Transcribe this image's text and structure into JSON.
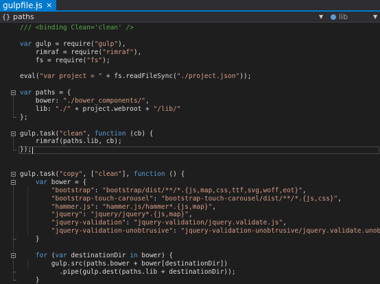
{
  "tab": {
    "title": "gulpfile.js",
    "pin_icon": "pin-icon",
    "close_icon": "close-icon"
  },
  "navbar": {
    "scope_icon": "braces-icon",
    "scope_icon_glyph": "{}",
    "scope_label": "paths",
    "member_icon": "object-icon",
    "member_label": "lib",
    "dropdown_icon": "dropdown-arrow-icon"
  },
  "colors": {
    "keyword": "#569cd6",
    "string": "#d69d85",
    "comment": "#57a64a",
    "plain": "#dcdcdc",
    "accent": "#007acc",
    "background": "#1e1e1e"
  },
  "code": {
    "lines": [
      [
        {
          "c": "com",
          "t": "/// <binding Clean='clean' />"
        }
      ],
      [],
      [
        {
          "c": "kw",
          "t": "var"
        },
        {
          "c": "pl",
          "t": " gulp = require("
        },
        {
          "c": "str",
          "t": "\"gulp\""
        },
        {
          "c": "pl",
          "t": "),"
        }
      ],
      [
        {
          "c": "pl",
          "t": "    rimraf = require("
        },
        {
          "c": "str",
          "t": "\"rimraf\""
        },
        {
          "c": "pl",
          "t": "),"
        }
      ],
      [
        {
          "c": "pl",
          "t": "    fs = require("
        },
        {
          "c": "str",
          "t": "\"fs\""
        },
        {
          "c": "pl",
          "t": ");"
        }
      ],
      [],
      [
        {
          "c": "pl",
          "t": "eval("
        },
        {
          "c": "str",
          "t": "\"var project = \""
        },
        {
          "c": "pl",
          "t": " + fs.readFileSync("
        },
        {
          "c": "str",
          "t": "\"./project.json\""
        },
        {
          "c": "pl",
          "t": "));"
        }
      ],
      [],
      [
        {
          "c": "kw",
          "t": "var"
        },
        {
          "c": "pl",
          "t": " paths = {"
        }
      ],
      [
        {
          "c": "pl",
          "t": "    bower: "
        },
        {
          "c": "str",
          "t": "\"./bower_components/\""
        },
        {
          "c": "pl",
          "t": ","
        }
      ],
      [
        {
          "c": "pl",
          "t": "    lib: "
        },
        {
          "c": "str",
          "t": "\"./\""
        },
        {
          "c": "pl",
          "t": " + project.webroot + "
        },
        {
          "c": "str",
          "t": "\"/lib/\""
        }
      ],
      [
        {
          "c": "pl",
          "t": "};"
        }
      ],
      [],
      [
        {
          "c": "pl",
          "t": "gulp.task("
        },
        {
          "c": "str",
          "t": "\"clean\""
        },
        {
          "c": "pl",
          "t": ", "
        },
        {
          "c": "kw",
          "t": "function"
        },
        {
          "c": "pl",
          "t": " (cb) {"
        }
      ],
      [
        {
          "c": "pl",
          "t": "    rimraf(paths.lib, cb);"
        }
      ],
      [
        {
          "c": "pl",
          "t": "});"
        }
      ],
      [],
      [],
      [
        {
          "c": "pl",
          "t": "gulp.task("
        },
        {
          "c": "str",
          "t": "\"copy\""
        },
        {
          "c": "pl",
          "t": ", ["
        },
        {
          "c": "str",
          "t": "\"clean\""
        },
        {
          "c": "pl",
          "t": "], "
        },
        {
          "c": "kw",
          "t": "function"
        },
        {
          "c": "pl",
          "t": " () {"
        }
      ],
      [
        {
          "c": "pl",
          "t": "    "
        },
        {
          "c": "kw",
          "t": "var"
        },
        {
          "c": "pl",
          "t": " bower = {"
        }
      ],
      [
        {
          "c": "pl",
          "t": "        "
        },
        {
          "c": "str",
          "t": "\"bootstrap\""
        },
        {
          "c": "pl",
          "t": ": "
        },
        {
          "c": "str",
          "t": "\"bootstrap/dist/**/*.{js,map,css,ttf,svg,woff,eot}\""
        },
        {
          "c": "pl",
          "t": ","
        }
      ],
      [
        {
          "c": "pl",
          "t": "        "
        },
        {
          "c": "str",
          "t": "\"bootstrap-touch-carousel\""
        },
        {
          "c": "pl",
          "t": ": "
        },
        {
          "c": "str",
          "t": "\"bootstrap-touch-carousel/dist/**/*.{js,css}\""
        },
        {
          "c": "pl",
          "t": ","
        }
      ],
      [
        {
          "c": "pl",
          "t": "        "
        },
        {
          "c": "str",
          "t": "\"hammer.js\""
        },
        {
          "c": "pl",
          "t": ": "
        },
        {
          "c": "str",
          "t": "\"hammer.js/hammer*.{js,map}\""
        },
        {
          "c": "pl",
          "t": ","
        }
      ],
      [
        {
          "c": "pl",
          "t": "        "
        },
        {
          "c": "str",
          "t": "\"jquery\""
        },
        {
          "c": "pl",
          "t": ": "
        },
        {
          "c": "str",
          "t": "\"jquery/jquery*.{js,map}\""
        },
        {
          "c": "pl",
          "t": ","
        }
      ],
      [
        {
          "c": "pl",
          "t": "        "
        },
        {
          "c": "str",
          "t": "\"jquery-validation\""
        },
        {
          "c": "pl",
          "t": ": "
        },
        {
          "c": "str",
          "t": "\"jquery-validation/jquery.validate.js\""
        },
        {
          "c": "pl",
          "t": ","
        }
      ],
      [
        {
          "c": "pl",
          "t": "        "
        },
        {
          "c": "str",
          "t": "\"jquery-validation-unobtrusive\""
        },
        {
          "c": "pl",
          "t": ": "
        },
        {
          "c": "str",
          "t": "\"jquery-validation-unobtrusive/jquery.validate.unobtrusive.js\""
        }
      ],
      [
        {
          "c": "pl",
          "t": "    }"
        }
      ],
      [],
      [
        {
          "c": "pl",
          "t": "    "
        },
        {
          "c": "kw",
          "t": "for"
        },
        {
          "c": "pl",
          "t": " ("
        },
        {
          "c": "kw",
          "t": "var"
        },
        {
          "c": "pl",
          "t": " destinationDir "
        },
        {
          "c": "kw",
          "t": "in"
        },
        {
          "c": "pl",
          "t": " bower) {"
        }
      ],
      [
        {
          "c": "pl",
          "t": "        gulp.src(paths.bower + bower[destinationDir])"
        }
      ],
      [
        {
          "c": "pl",
          "t": "          .pipe(gulp.dest(paths.lib + destinationDir));"
        }
      ],
      [
        {
          "c": "pl",
          "t": "    }"
        }
      ],
      [
        {
          "c": "pl",
          "t": "});"
        }
      ]
    ]
  }
}
